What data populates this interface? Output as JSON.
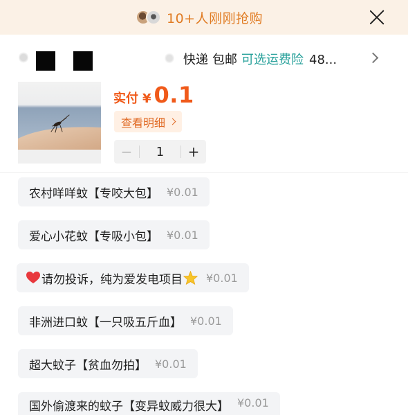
{
  "banner": {
    "text": "10+人刚刚抢购",
    "avatars": [
      "avatar-1",
      "avatar-2"
    ],
    "close_icon": "close-icon"
  },
  "shipping": {
    "courier": "快递",
    "free_shipping": "包邮",
    "insurance": "可选运费险",
    "insurance_value": "48...",
    "chevron_icon": "chevron-right-icon"
  },
  "product": {
    "price_label": "实付",
    "currency": "¥",
    "price_value": "0.1",
    "detail_label": "查看明细",
    "quantity": "1",
    "minus_label": "−",
    "plus_label": "+"
  },
  "options": [
    {
      "label": "农村咩咩蚊【专咬大包】",
      "price": "¥0.01"
    },
    {
      "label": "爱心小花蚊【专吸小包】",
      "price": "¥0.01"
    },
    {
      "label": "请勿投诉，纯为爱发电项目",
      "price": "¥0.01",
      "prefix_icon": "heart-icon",
      "suffix_icon": "star-icon"
    },
    {
      "label": "非洲进口蚊【一只吸五斤血】",
      "price": "¥0.01"
    },
    {
      "label": "超大蚊子【贫血勿拍】",
      "price": "¥0.01"
    },
    {
      "label": "国外偷渡来的蚊子【变异蚊威力很大】",
      "price": "¥0.01"
    }
  ],
  "colors": {
    "accent_orange": "#f05a1a",
    "banner_text": "#e07b22",
    "insurance_green": "#26a09a",
    "banner_bg": "#fbf1e6"
  }
}
